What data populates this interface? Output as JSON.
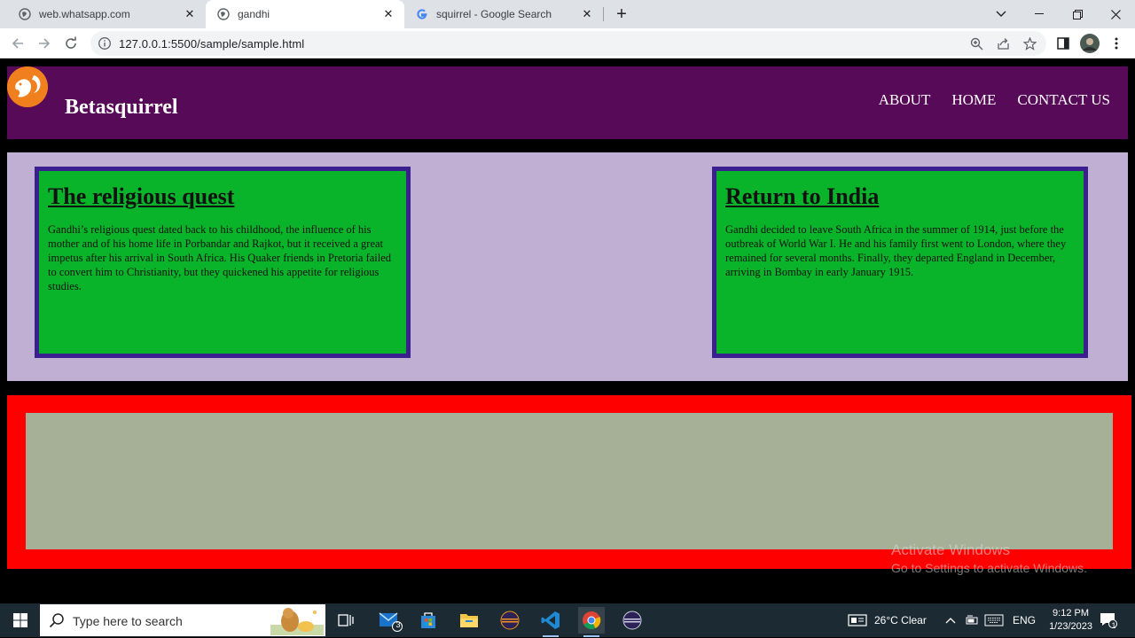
{
  "browser": {
    "tabs": [
      {
        "title": "web.whatsapp.com",
        "icon": "globe-icon",
        "active": false
      },
      {
        "title": "gandhi",
        "icon": "globe-icon",
        "active": true
      },
      {
        "title": "squirrel - Google Search",
        "icon": "google-icon",
        "active": false
      }
    ],
    "url": "127.0.0.1:5500/sample/sample.html"
  },
  "site": {
    "brand": "Betasquirrel",
    "menu": [
      "ABOUT",
      "HOME",
      "CONTACT US"
    ],
    "cards": [
      {
        "title": "The religious quest",
        "body": "Gandhi’s religious quest dated back to his childhood, the influence of his mother and of his home life in Porbandar and Rajkot, but it received a great impetus after his arrival in South Africa. His Quaker friends in Pretoria failed to convert him to Christianity, but they quickened his appetite for religious studies."
      },
      {
        "title": "Return to India",
        "body": "Gandhi decided to leave South Africa in the summer of 1914, just before the outbreak of World War I. He and his family first went to London, where they remained for several months. Finally, they departed England in December, arriving in Bombay in early January 1915."
      }
    ],
    "colors": {
      "nav": "#570a57",
      "cards_bg": "#c1afd3",
      "card": "#0ab42a",
      "card_border": "#3a1f8f",
      "footer": "#ff0000",
      "footer_inner": "#a6b096"
    }
  },
  "watermark": {
    "line1": "Activate Windows",
    "line2": "Go to Settings to activate Windows."
  },
  "taskbar": {
    "search_placeholder": "Type here to search",
    "mail_badge": "3",
    "weather": "26°C  Clear",
    "language": "ENG",
    "time": "9:12 PM",
    "date": "1/23/2023",
    "notification_count": "1"
  }
}
